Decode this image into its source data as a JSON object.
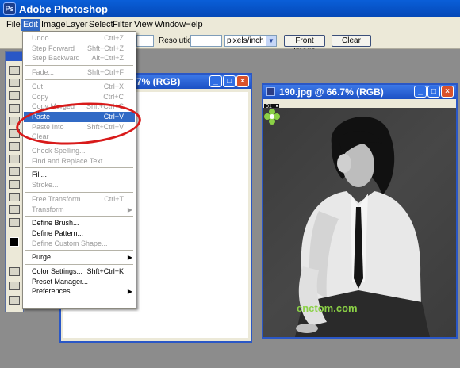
{
  "app": {
    "title": "Adobe Photoshop",
    "logo_glyph": "Ps"
  },
  "menubar": [
    "File",
    "Edit",
    "Image",
    "Layer",
    "Select",
    "Filter",
    "View",
    "Window",
    "Help"
  ],
  "active_menu": "Edit",
  "options_bar": {
    "resolution_label": "Resolution:",
    "resolution_value": "",
    "units": "pixels/inch",
    "front_image_button": "Front Image",
    "clear_button": "Clear"
  },
  "doc_windows": [
    {
      "title_visible": "7% (RGB)"
    },
    {
      "title": "190.jpg @ 66.7% (RGB)",
      "layer_chips": [
        "01",
        "▪"
      ],
      "watermark": "cnctom.com"
    }
  ],
  "edit_menu": {
    "items": [
      {
        "label": "Undo",
        "shortcut": "Ctrl+Z",
        "disabled": true
      },
      {
        "label": "Step Forward",
        "shortcut": "Shft+Ctrl+Z",
        "disabled": true
      },
      {
        "label": "Step Backward",
        "shortcut": "Alt+Ctrl+Z",
        "disabled": true
      },
      {
        "sep": true
      },
      {
        "label": "Fade...",
        "shortcut": "Shft+Ctrl+F",
        "disabled": true
      },
      {
        "sep": true
      },
      {
        "label": "Cut",
        "shortcut": "Ctrl+X",
        "disabled": true
      },
      {
        "label": "Copy",
        "shortcut": "Ctrl+C",
        "disabled": true
      },
      {
        "label": "Copy Merged",
        "shortcut": "Shft+Ctrl+C",
        "disabled": true
      },
      {
        "label": "Paste",
        "shortcut": "Ctrl+V",
        "disabled": false,
        "highlighted": true
      },
      {
        "label": "Paste Into",
        "shortcut": "Shft+Ctrl+V",
        "disabled": true
      },
      {
        "label": "Clear",
        "shortcut": "",
        "disabled": true
      },
      {
        "sep": true
      },
      {
        "label": "Check Spelling...",
        "shortcut": "",
        "disabled": true
      },
      {
        "label": "Find and Replace Text...",
        "shortcut": "",
        "disabled": true
      },
      {
        "sep": true
      },
      {
        "label": "Fill...",
        "shortcut": "",
        "disabled": false
      },
      {
        "label": "Stroke...",
        "shortcut": "",
        "disabled": true
      },
      {
        "sep": true
      },
      {
        "label": "Free Transform",
        "shortcut": "Ctrl+T",
        "disabled": true
      },
      {
        "label": "Transform",
        "shortcut": "",
        "disabled": true,
        "submenu": true
      },
      {
        "sep": true
      },
      {
        "label": "Define Brush...",
        "shortcut": "",
        "disabled": false
      },
      {
        "label": "Define Pattern...",
        "shortcut": "",
        "disabled": false
      },
      {
        "label": "Define Custom Shape...",
        "shortcut": "",
        "disabled": true
      },
      {
        "sep": true
      },
      {
        "label": "Purge",
        "shortcut": "",
        "disabled": false,
        "submenu": true
      },
      {
        "sep": true
      },
      {
        "label": "Color Settings...",
        "shortcut": "Shft+Ctrl+K",
        "disabled": false
      },
      {
        "label": "Preset Manager...",
        "shortcut": "",
        "disabled": false
      },
      {
        "label": "Preferences",
        "shortcut": "",
        "disabled": false,
        "submenu": true
      }
    ]
  },
  "colors": {
    "highlight": "#316ac5",
    "titlebar": "#0a5fd8",
    "annotation_ring": "#d81a1a",
    "watermark": "#8bd146"
  }
}
